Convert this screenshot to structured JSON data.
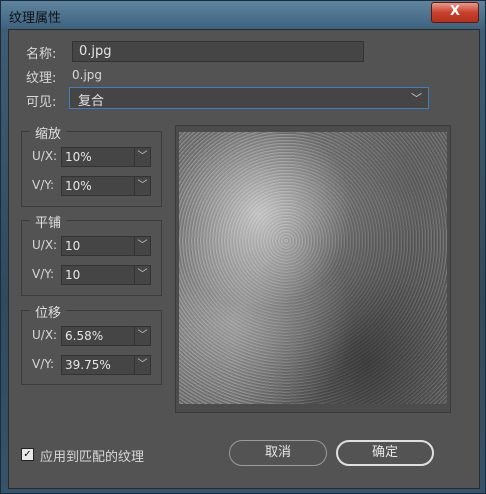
{
  "window": {
    "title": "纹理属性",
    "close": "X"
  },
  "name": {
    "label": "名称:",
    "value": "0.jpg"
  },
  "texture": {
    "label": "纹理:",
    "value": "0.jpg"
  },
  "visible": {
    "label": "可见:",
    "value": "复合"
  },
  "scale": {
    "title": "缩放",
    "ux_label": "U/X:",
    "ux": "10%",
    "vy_label": "V/Y:",
    "vy": "10%"
  },
  "tile": {
    "title": "平铺",
    "ux_label": "U/X:",
    "ux": "10",
    "vy_label": "V/Y:",
    "vy": "10"
  },
  "offset": {
    "title": "位移",
    "ux_label": "U/X:",
    "ux": "6.58%",
    "vy_label": "V/Y:",
    "vy": "39.75%"
  },
  "apply_matching": {
    "label": "应用到匹配的纹理",
    "checked": true
  },
  "buttons": {
    "cancel": "取消",
    "ok": "确定"
  },
  "icons": {
    "checkbox": "check-icon",
    "dropdown": "chevron-down-icon"
  }
}
